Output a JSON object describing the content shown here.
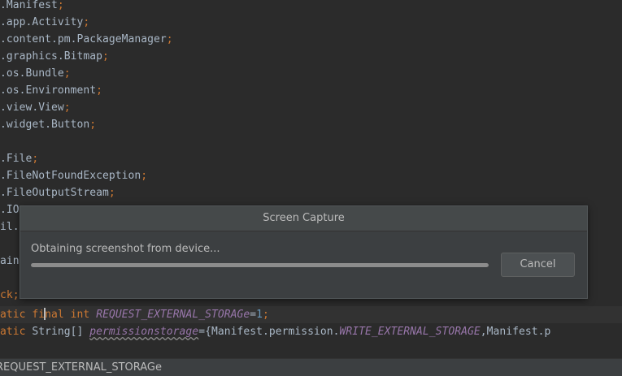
{
  "editor": {
    "lines": [
      {
        "text": ".Manifest",
        "end": ";"
      },
      {
        "text": ".app.Activity",
        "end": ";"
      },
      {
        "text": ".content.pm.PackageManager",
        "end": ";"
      },
      {
        "text": ".graphics.Bitmap",
        "end": ";"
      },
      {
        "text": ".os.Bundle",
        "end": ";"
      },
      {
        "text": ".os.Environment",
        "end": ";"
      },
      {
        "text": ".view.View",
        "end": ";"
      },
      {
        "text": ".widget.Button",
        "end": ";"
      },
      {
        "text": "",
        "end": ""
      },
      {
        "text": ".File",
        "end": ";"
      },
      {
        "text": ".FileNotFoundException",
        "end": ";"
      },
      {
        "text": ".FileOutputStream",
        "end": ";"
      },
      {
        "text": ".IO",
        "end": ""
      },
      {
        "text": "il.",
        "end": ""
      },
      {
        "text": "",
        "end": ""
      },
      {
        "text": "ain",
        "end": ""
      },
      {
        "text": "",
        "end": ""
      },
      {
        "text": "ck",
        "end": ";"
      }
    ],
    "line18": {
      "kw1": "atic ",
      "kw2a": "fi",
      "kw2b": "nal ",
      "kw3": "int ",
      "field": "REQUEST_EXTERNAL_STORAGe",
      "op": "=",
      "num": "1",
      "end": ";"
    },
    "line19": {
      "kw1": "atic ",
      "type": "String[] ",
      "field": "permissionstorage",
      "op": "={Manifest.permission.",
      "field2": "WRITE_EXTERNAL_STORAGE",
      "rest": ",Manifest.p"
    }
  },
  "bottom_bar": {
    "text": "REQUEST_EXTERNAL_STORAGe"
  },
  "dialog": {
    "title": "Screen Capture",
    "message": "Obtaining screenshot from device...",
    "progress": 1.0,
    "cancel_label": "Cancel"
  }
}
